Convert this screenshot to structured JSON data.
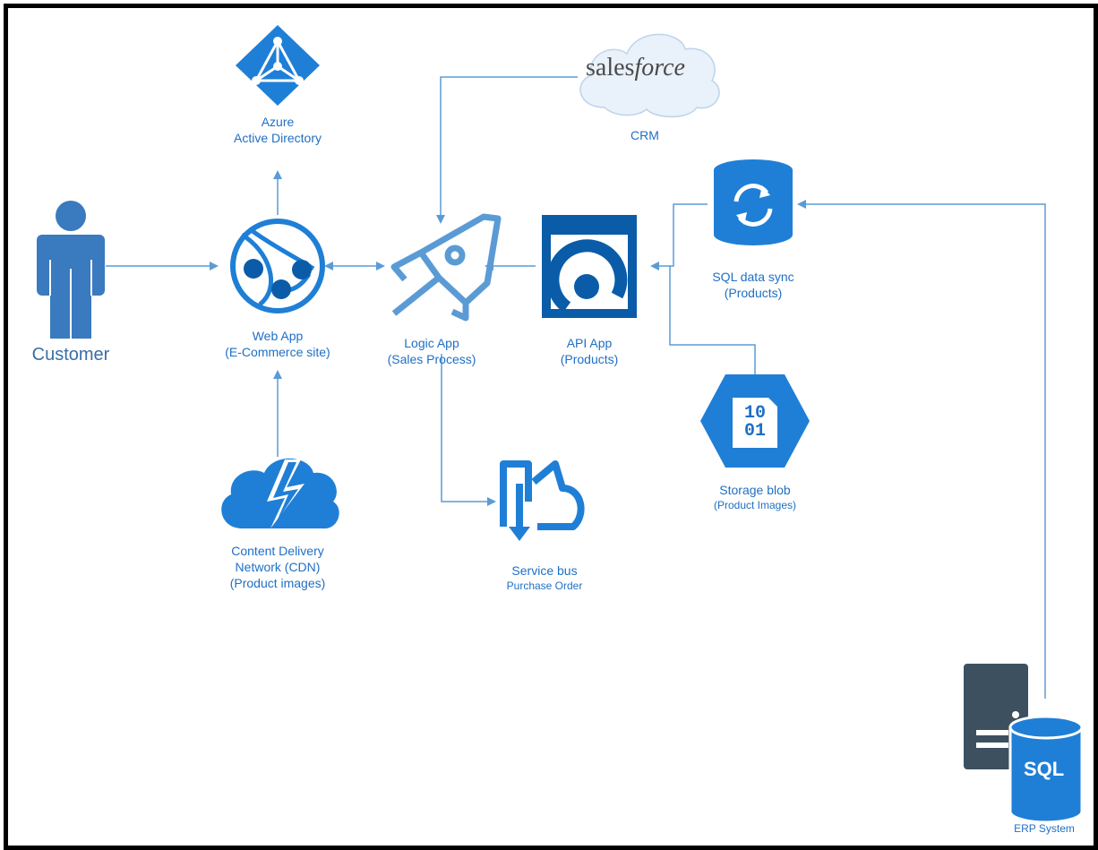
{
  "nodes": {
    "customer": {
      "label": "Customer"
    },
    "aad": {
      "line1": "Azure",
      "line2": "Active Directory"
    },
    "crm": {
      "logo_left": "sales",
      "logo_right": "force",
      "label": "CRM"
    },
    "web_app": {
      "line1": "Web App",
      "line2": "(E-Commerce site)"
    },
    "logic_app": {
      "line1": "Logic App",
      "line2": "(Sales Process)"
    },
    "api_app": {
      "line1": "API App",
      "line2": "(Products)"
    },
    "sql_sync": {
      "line1": "SQL data sync",
      "line2": "(Products)"
    },
    "storage": {
      "line1": "Storage blob",
      "line2": "(Product Images)",
      "glyph_top": "10",
      "glyph_bottom": "01"
    },
    "cdn": {
      "line1": "Content Delivery",
      "line2": "Network (CDN)",
      "line3": "(Product images)"
    },
    "service_bus": {
      "line1": "Service bus",
      "line2": "Purchase Order"
    },
    "erp": {
      "label": "ERP System",
      "db_text": "SQL"
    }
  },
  "colors": {
    "azure_blue": "#1f7fd6",
    "dark_blue": "#0a5ca8",
    "customer_blue": "#3a7abf",
    "logic_blue": "#5b9bd5",
    "connector": "#5b9bd5",
    "server_gray": "#3d5060",
    "cloud_fill": "#e9f1fa"
  },
  "icons": [
    "azure-ad-icon",
    "salesforce-cloud-icon",
    "customer-person-icon",
    "web-app-globe-icon",
    "logic-app-rocket-icon",
    "api-app-icon",
    "sql-sync-icon",
    "storage-blob-icon",
    "cdn-cloud-icon",
    "service-bus-icon",
    "erp-server-icon",
    "sql-database-icon"
  ]
}
